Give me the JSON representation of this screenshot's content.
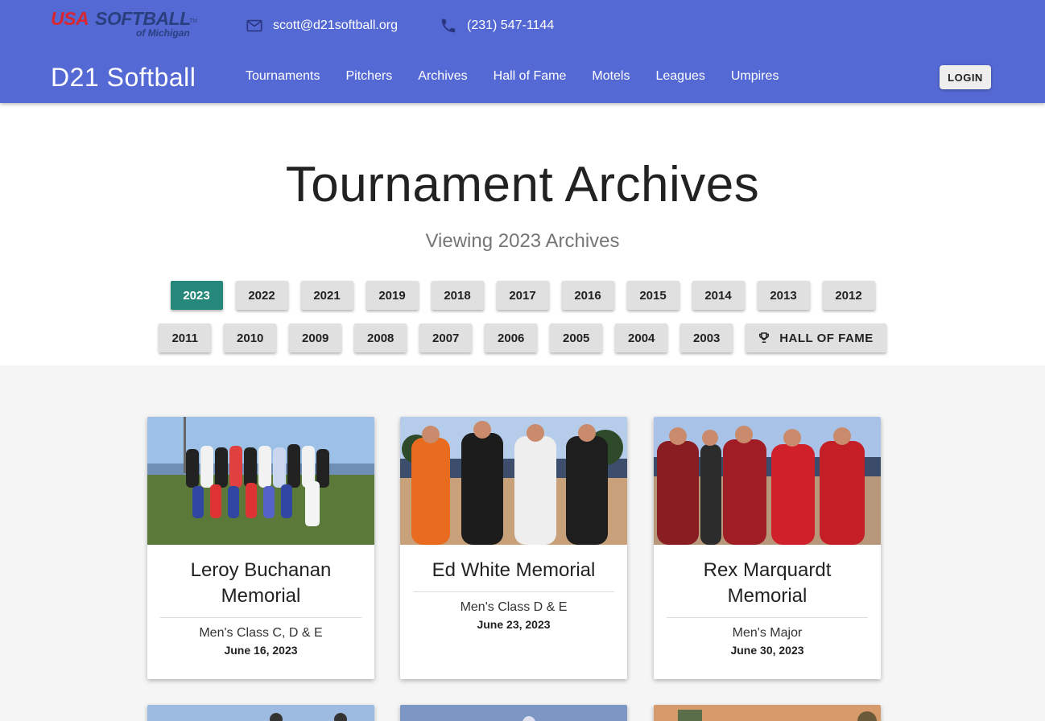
{
  "header": {
    "logo": {
      "line1a": "USA",
      "line1b": "SOFTBALL",
      "tm": "TM",
      "line2": "of Michigan"
    },
    "email": "scott@d21softball.org",
    "phone": "(231) 547-1144",
    "brand": "D21 Softball",
    "nav": [
      "Tournaments",
      "Pitchers",
      "Archives",
      "Hall of Fame",
      "Motels",
      "Leagues",
      "Umpires"
    ],
    "login_label": "LOGIN"
  },
  "hero": {
    "title": "Tournament Archives",
    "subtitle": "Viewing 2023 Archives",
    "years_row1": [
      "2023",
      "2022",
      "2021",
      "2019",
      "2018",
      "2017",
      "2016",
      "2015",
      "2014",
      "2013",
      "2012"
    ],
    "years_row2": [
      "2011",
      "2010",
      "2009",
      "2008",
      "2007",
      "2006",
      "2005",
      "2004",
      "2003"
    ],
    "active_year": "2023",
    "hof_label": "HALL OF FAME"
  },
  "cards": [
    {
      "title": "Leroy Buchanan Memorial",
      "class": "Men's Class C, D & E",
      "date": "June 16, 2023"
    },
    {
      "title": "Ed White Memorial",
      "class": "Men's Class D & E",
      "date": "June 23, 2023"
    },
    {
      "title": "Rex Marquardt Memorial",
      "class": "Men's Major",
      "date": "June 30, 2023"
    }
  ],
  "colors": {
    "header": "#5469d4",
    "active_year": "#26887a",
    "button": "#e0e0e0"
  }
}
